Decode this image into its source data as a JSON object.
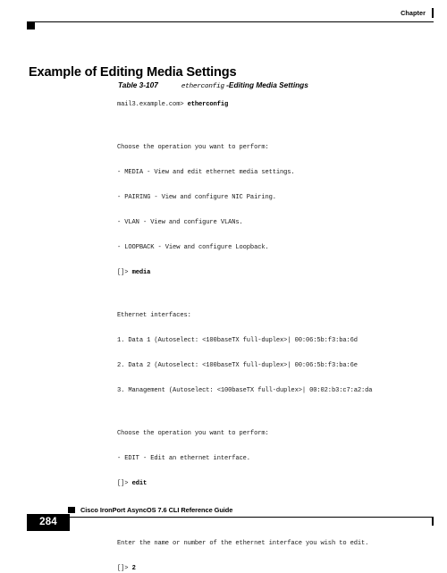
{
  "header": {
    "label": "Chapter"
  },
  "heading": "Example of Editing Media Settings",
  "caption": {
    "number": "Table 3-107",
    "code": "etherconfig",
    "title": "-Editing Media Settings"
  },
  "cli": {
    "lines": [
      {
        "text": "mail3.example.com> ",
        "bold": "etherconfig",
        "spacing": "none"
      },
      {
        "text": "",
        "spacing": "blank"
      },
      {
        "text": "",
        "spacing": "blank"
      },
      {
        "text": "Choose the operation you want to perform:",
        "spacing": "none"
      },
      {
        "text": "",
        "spacing": "blank"
      },
      {
        "text": "- MEDIA - View and edit ethernet media settings.",
        "spacing": "none"
      },
      {
        "text": "",
        "spacing": "blank"
      },
      {
        "text": "- PAIRING - View and configure NIC Pairing.",
        "spacing": "none"
      },
      {
        "text": "",
        "spacing": "blank"
      },
      {
        "text": "- VLAN - View and configure VLANs.",
        "spacing": "none"
      },
      {
        "text": "",
        "spacing": "blank"
      },
      {
        "text": "- LOOPBACK - View and configure Loopback.",
        "spacing": "none"
      },
      {
        "text": "",
        "spacing": "blank"
      },
      {
        "text": "[]> ",
        "bold": "media",
        "spacing": "none"
      },
      {
        "text": "",
        "spacing": "blank"
      },
      {
        "text": "",
        "spacing": "blank"
      },
      {
        "text": "Ethernet interfaces:",
        "spacing": "none"
      },
      {
        "text": "",
        "spacing": "blank"
      },
      {
        "text": "1. Data 1 (Autoselect: <100baseTX full-duplex>| 00:06:5b:f3:ba:6d",
        "spacing": "none"
      },
      {
        "text": "",
        "spacing": "blank"
      },
      {
        "text": "2. Data 2 (Autoselect: <100baseTX full-duplex>| 00:06:5b:f3:ba:6e",
        "spacing": "none"
      },
      {
        "text": "",
        "spacing": "blank"
      },
      {
        "text": "3. Management (Autoselect: <100baseTX full-duplex>| 00:02:b3:c7:a2:da",
        "spacing": "none"
      },
      {
        "text": "",
        "spacing": "blank"
      },
      {
        "text": "",
        "spacing": "blank"
      },
      {
        "text": "Choose the operation you want to perform:",
        "spacing": "none"
      },
      {
        "text": "",
        "spacing": "blank"
      },
      {
        "text": "- EDIT - Edit an ethernet interface.",
        "spacing": "none"
      },
      {
        "text": "",
        "spacing": "blank"
      },
      {
        "text": "[]> ",
        "bold": "edit",
        "spacing": "none"
      },
      {
        "text": "",
        "spacing": "blank"
      },
      {
        "text": "",
        "spacing": "blank"
      },
      {
        "text": "",
        "spacing": "blank"
      },
      {
        "text": "Enter the name or number of the ethernet interface you wish to edit.",
        "spacing": "none"
      },
      {
        "text": "",
        "spacing": "blank"
      },
      {
        "text": "[]> ",
        "bold": "2",
        "spacing": "none"
      }
    ]
  },
  "footer": {
    "title": "Cisco IronPort AsyncOS 7.6 CLI Reference Guide",
    "page_number": "284"
  }
}
